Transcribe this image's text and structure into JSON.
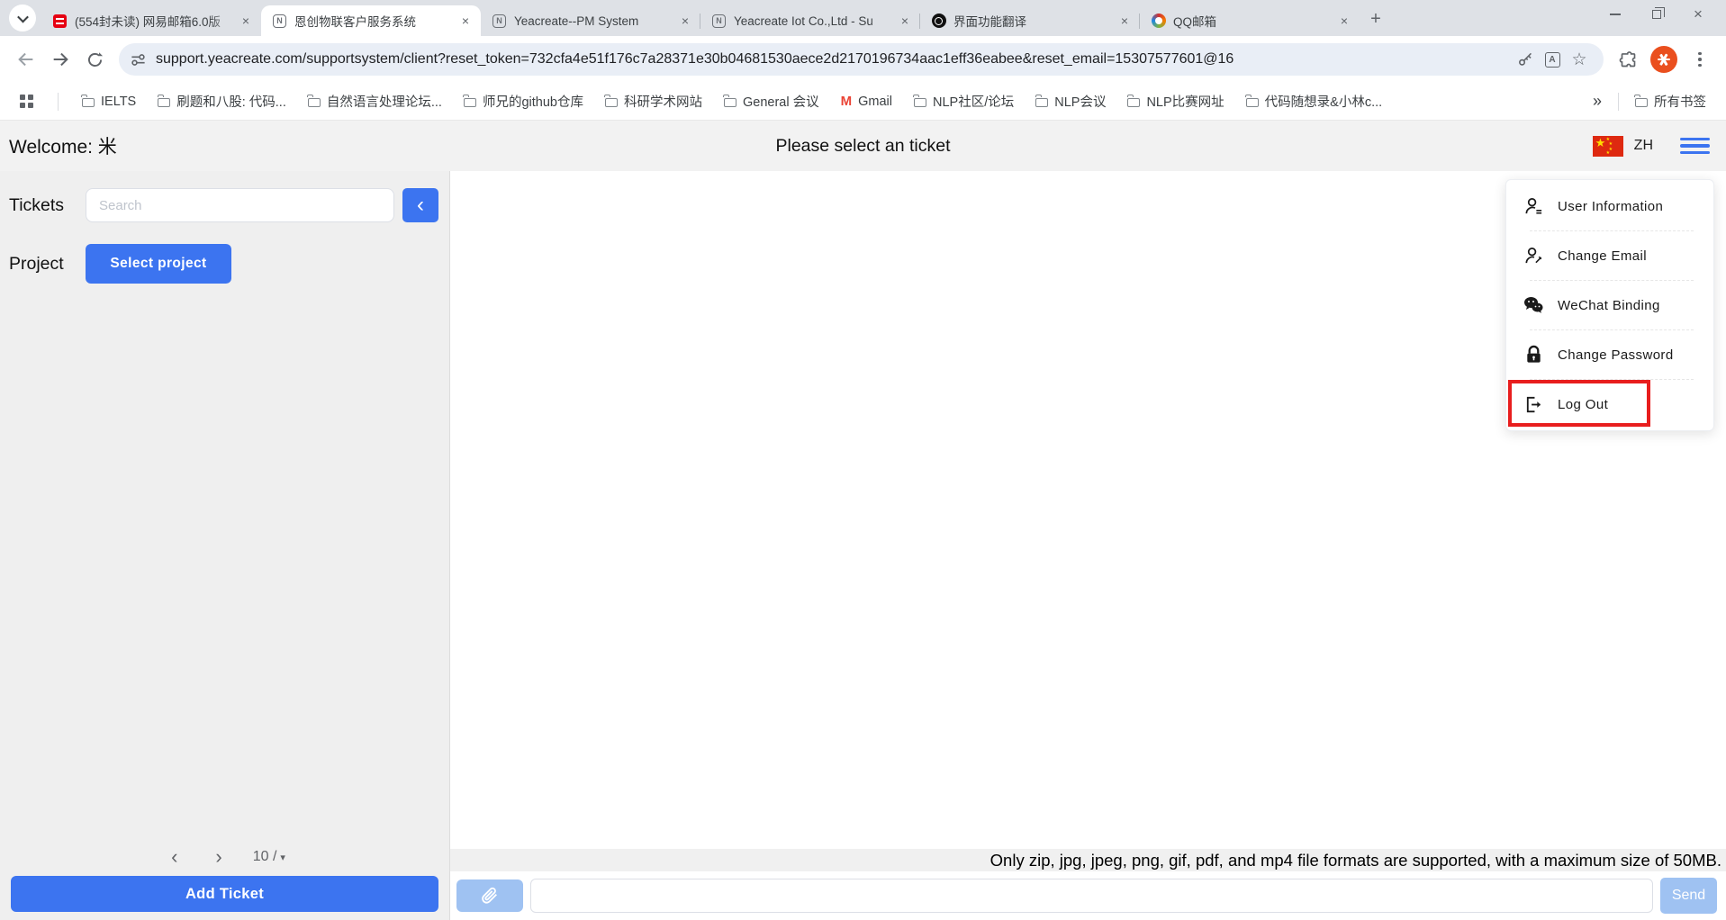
{
  "browser": {
    "tabs": [
      {
        "title": "(554封未读) 网易邮箱6.0版"
      },
      {
        "title": "恩创物联客户服务系统"
      },
      {
        "title": "Yeacreate--PM System"
      },
      {
        "title": "Yeacreate Iot Co.,Ltd - Su"
      },
      {
        "title": "界面功能翻译"
      },
      {
        "title": "QQ邮箱"
      }
    ],
    "new_tab_label": "+",
    "url": "support.yeacreate.com/supportsystem/client?reset_token=732cfa4e51f176c7a28371e30b04681530aece2d2170196734aac1eff36eabee&reset_email=15307577601@16",
    "bookmarks": [
      "IELTS",
      "刷题和八股: 代码...",
      "自然语言处理论坛...",
      "师兄的github仓库",
      "科研学术网站",
      "General 会议",
      "Gmail",
      "NLP社区/论坛",
      "NLP会议",
      "NLP比赛网址",
      "代码随想录&小林c...",
      "»",
      "所有书签"
    ]
  },
  "header": {
    "welcome": "Welcome: 米",
    "title": "Please select an ticket",
    "lang": "ZH"
  },
  "sidebar": {
    "tickets_label": "Tickets",
    "search_placeholder": "Search",
    "project_label": "Project",
    "select_project_label": "Select project",
    "prev_label": "‹",
    "next_label": "›",
    "page_size": "10 /",
    "add_ticket_label": "Add Ticket"
  },
  "menu": {
    "items": [
      {
        "label": "User Information"
      },
      {
        "label": "Change Email"
      },
      {
        "label": "WeChat Binding"
      },
      {
        "label": "Change Password"
      },
      {
        "label": "Log Out"
      }
    ]
  },
  "composer": {
    "notice": "Only zip, jpg, jpeg, png, gif, pdf, and mp4 file formats are supported, with a maximum size of 50MB.",
    "message_value": "",
    "send_label": "Send"
  },
  "colors": {
    "primary": "#3c74f0",
    "disabled_blue": "#9fc2f2",
    "danger": "#e81e1e",
    "flag_red": "#de2910"
  }
}
